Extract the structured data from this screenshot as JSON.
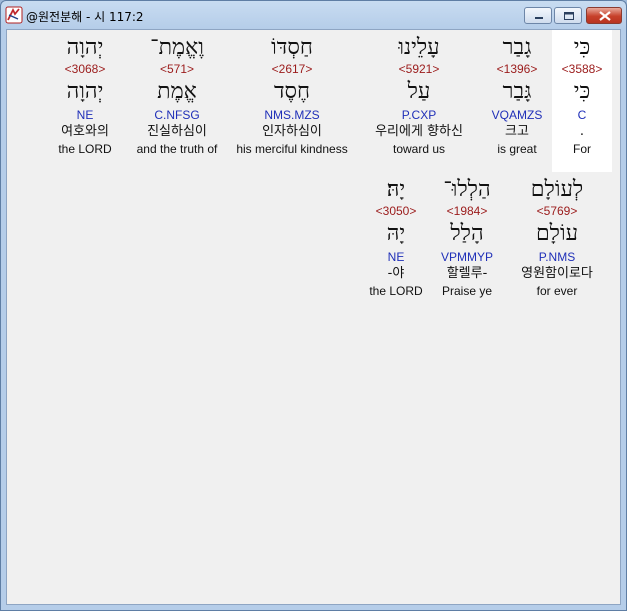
{
  "window": {
    "title": "@원전분해 - 시 117:2",
    "app_icon": "app-logo-icon",
    "controls": [
      "minimize-icon",
      "maximize-icon",
      "close-icon"
    ]
  },
  "verse_rows": [
    {
      "words": [
        {
          "hebrew": "כִּי",
          "strong": "<3588>",
          "lemma": "כִּי",
          "morph": "C",
          "korean": ".",
          "english": "For",
          "selected": true
        },
        {
          "hebrew": "גָבַר",
          "strong": "<1396>",
          "lemma": "גָּבַר",
          "morph": "VQAMZS",
          "korean": "크고",
          "english": "is great"
        },
        {
          "hebrew": "עָלֵינוּ",
          "strong": "<5921>",
          "lemma": "עַל",
          "morph": "P.CXP",
          "korean": "우리에게 향하신",
          "english": "toward us"
        },
        {
          "hebrew": "חַסְדּוֹ",
          "strong": "<2617>",
          "lemma": "חֶסֶד",
          "morph": "NMS.MZS",
          "korean": "인자하심이",
          "english": "his merciful kindness"
        },
        {
          "hebrew": "וֶאֱמֶת־",
          "strong": "<571>",
          "lemma": "אֱמֶת",
          "morph": "C.NFSG",
          "korean": "진실하심이",
          "english": "and the truth of"
        },
        {
          "hebrew": "יְהוָה",
          "strong": "<3068>",
          "lemma": "יְהוָה",
          "morph": "NE",
          "korean": "여호와의",
          "english": "the LORD"
        }
      ]
    },
    {
      "words": [
        {
          "hebrew": "לְעוֹלָם",
          "strong": "<5769>",
          "lemma": "עוֹלָם",
          "morph": "P.NMS",
          "korean": "영원함이로다",
          "english": "for ever"
        },
        {
          "hebrew": "הַלְלוּ־",
          "strong": "<1984>",
          "lemma": "הָלַל",
          "morph": "VPMMYP",
          "korean": "할렐루-",
          "english": "Praise ye"
        },
        {
          "hebrew": "יָהּ׃",
          "strong": "<3050>",
          "lemma": "יָהּ",
          "morph": "NE",
          "korean": "-야",
          "english": "the LORD"
        }
      ]
    }
  ]
}
